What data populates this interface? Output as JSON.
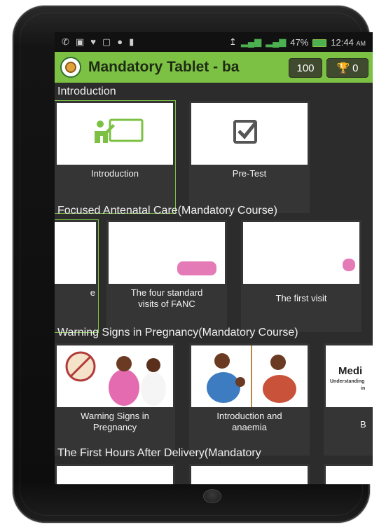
{
  "status_bar": {
    "battery": "47%",
    "time": "12:44",
    "time_suffix": "AM"
  },
  "app_bar": {
    "title": "Mandatory Tablet - ba",
    "points": "100",
    "trophies": "0"
  },
  "sections": [
    {
      "title": "Introduction",
      "cards": [
        {
          "label": "Introduction",
          "icon": "teacher-board-icon"
        },
        {
          "label": "Pre-Test",
          "icon": "checkbox-checked-icon"
        }
      ]
    },
    {
      "title": "Focused Antenatal Care(Mandatory Course)",
      "cards": [
        {
          "label": "e"
        },
        {
          "label_line1": "The four standard",
          "label_line2": "visits of FANC"
        },
        {
          "label": "The first visit"
        }
      ]
    },
    {
      "title": "Warning Signs in Pregnancy(Mandatory Course)",
      "cards": [
        {
          "label_line1": "Warning Signs in",
          "label_line2": "Pregnancy"
        },
        {
          "label_line1": "Introduction and",
          "label_line2": "anaemia"
        },
        {
          "label": "B",
          "thumb_text": "Medi",
          "thumb_subtext": "Understanding",
          "thumb_subtext2": "in"
        }
      ]
    },
    {
      "title": "The First Hours After Delivery(Mandatory"
    }
  ],
  "colors": {
    "accent": "#7cc143",
    "background": "#2c2c2c"
  }
}
